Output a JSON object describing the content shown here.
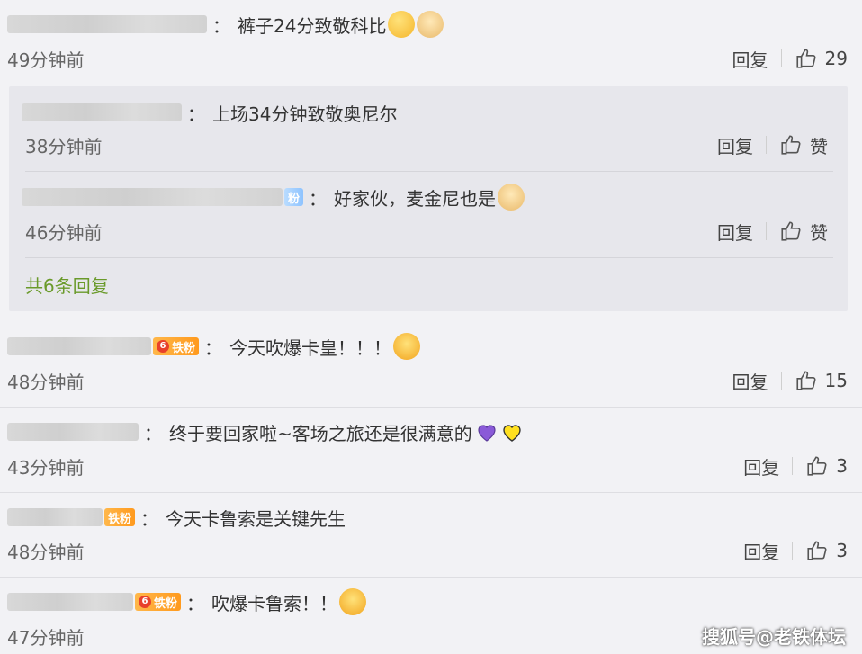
{
  "comments": [
    {
      "text": "裤子24分致敬科比",
      "time": "49分钟前",
      "reply": "回复",
      "likes": "29"
    },
    {
      "text": "今天吹爆卡皇！！！",
      "badge": "铁粉",
      "level": "6",
      "time": "48分钟前",
      "reply": "回复",
      "likes": "15"
    },
    {
      "text": "终于要回家啦~客场之旅还是很满意的",
      "time": "43分钟前",
      "reply": "回复",
      "likes": "3"
    },
    {
      "text": "今天卡鲁索是关键先生",
      "badge": "铁粉",
      "time": "48分钟前",
      "reply": "回复",
      "likes": "3"
    },
    {
      "text": "吹爆卡鲁索！！",
      "badge": "铁粉",
      "level": "6",
      "time": "47分钟前"
    }
  ],
  "replies": [
    {
      "text": "上场34分钟致敬奥尼尔",
      "time": "38分钟前",
      "reply": "回复",
      "like": "赞"
    },
    {
      "text": "好家伙，麦金尼也是",
      "badge": "粉",
      "time": "46分钟前",
      "reply": "回复",
      "like": "赞"
    }
  ],
  "replies_more": "共6条回复",
  "colon": "：",
  "watermark": "搜狐号@老铁体坛",
  "colors": {
    "background": "#f2f2f5",
    "reply_panel": "#e7e7ec",
    "link_green": "#6a9a2a",
    "badge_orange": "#ff9a1e"
  }
}
